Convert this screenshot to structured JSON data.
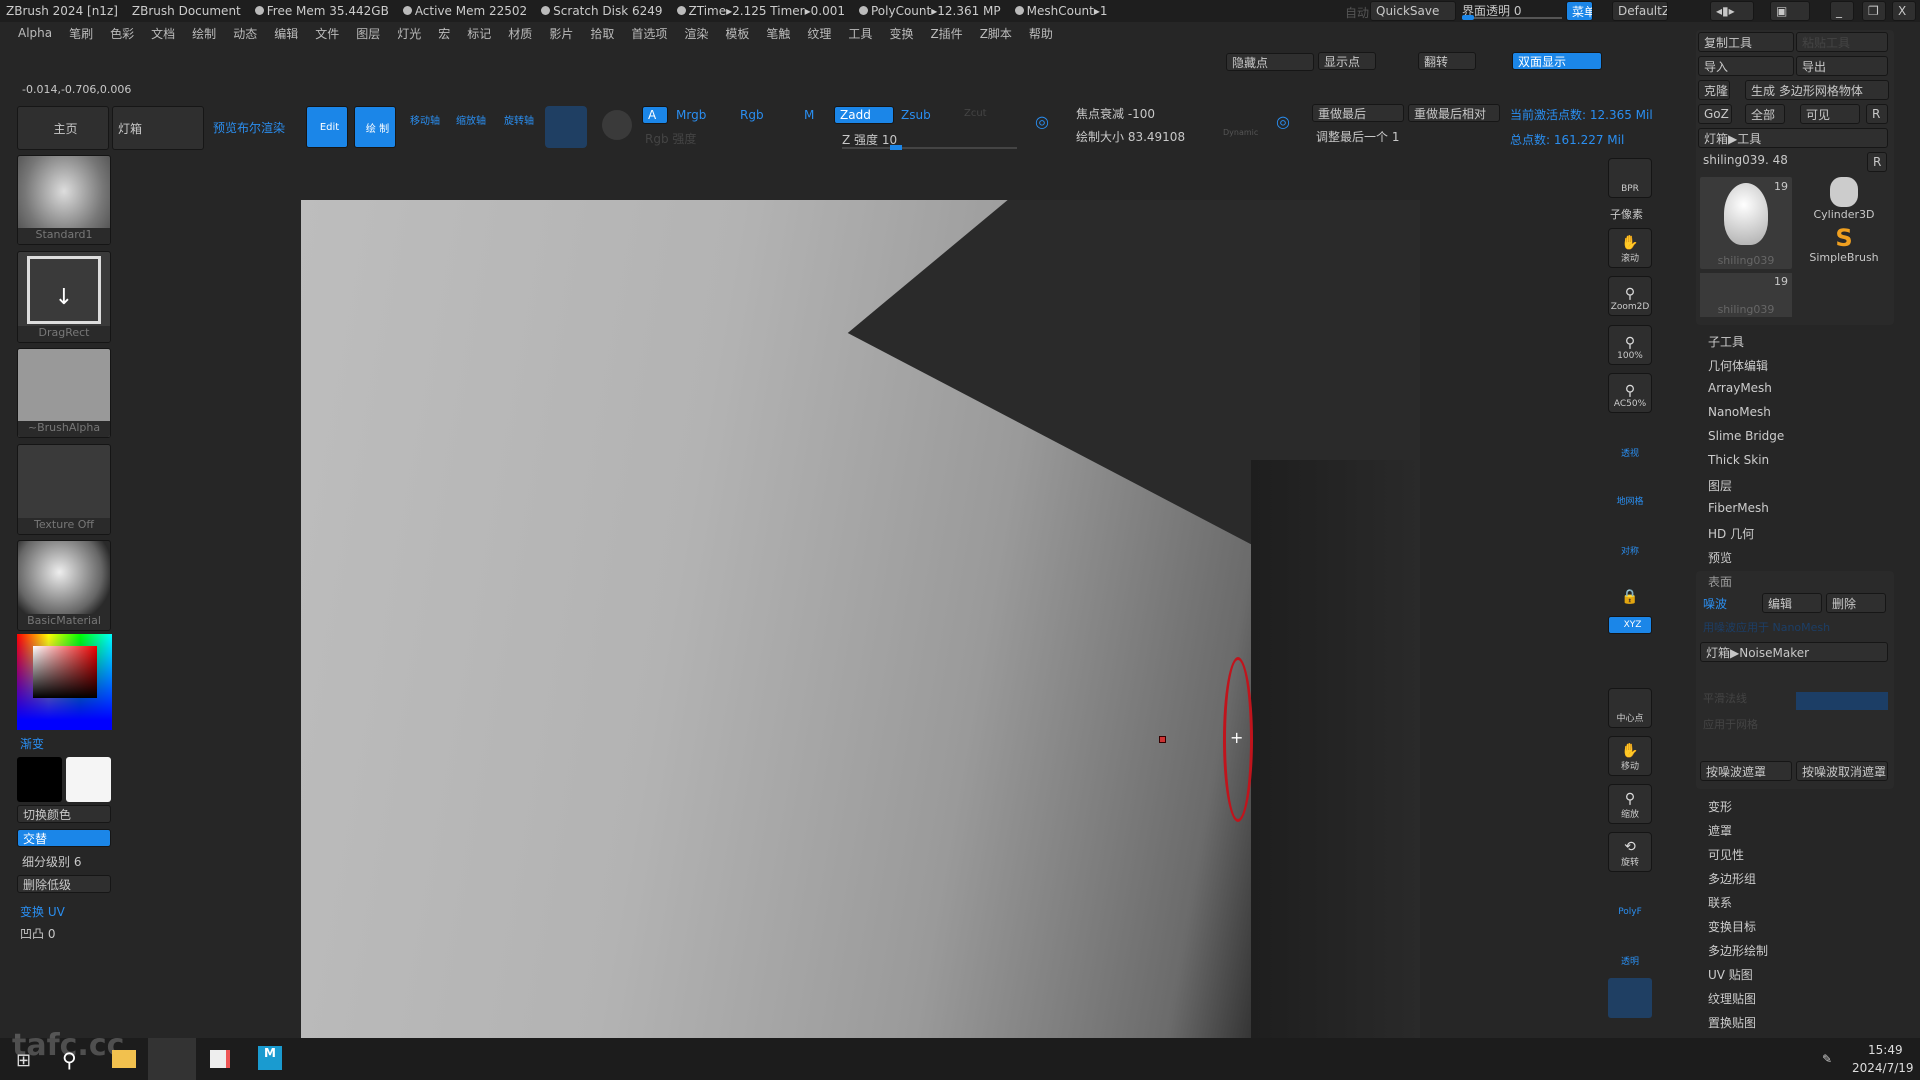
{
  "title": {
    "app": "ZBrush 2024 [n1z]",
    "doc": "ZBrush Document",
    "free_mem": "Free Mem 35.442GB",
    "active_mem": "Active Mem 22502",
    "scratch": "Scratch Disk 6249",
    "ztime": "ZTime▸2.125 Timer▸0.001",
    "polycount": "PolyCount▸12.361 MP",
    "meshcount": "MeshCount▸1",
    "auto": "自动",
    "quicksave": "QuickSave",
    "ui_opacity": "界面透明 0",
    "menu": "菜单",
    "script": "DefaultZScript"
  },
  "menus": [
    "Alpha",
    "笔刷",
    "色彩",
    "文档",
    "绘制",
    "动态",
    "编辑",
    "文件",
    "图层",
    "灯光",
    "宏",
    "标记",
    "材质",
    "影片",
    "拾取",
    "首选项",
    "渲染",
    "模板",
    "笔触",
    "纹理",
    "工具",
    "变换",
    "Z插件",
    "Z脚本",
    "帮助"
  ],
  "coords": "-0.014,-0.706,0.006",
  "toolbar": {
    "home": "主页",
    "lightbox": "灯箱",
    "preview_boolean": "预览布尔渲染",
    "edit": "Edit",
    "draw": "绘 制",
    "move": "移动轴",
    "scale": "缩放轴",
    "rotate": "旋转轴",
    "a": "A",
    "mrgb": "Mrgb",
    "rgb": "Rgb",
    "m": "M",
    "zadd": "Zadd",
    "zsub": "Zsub",
    "zcut": "Zcut",
    "rgb_intensity": "Rgb 强度",
    "z_intensity": "Z 强度 10",
    "focal": "焦点衰减 -100",
    "draw_size": "绘制大小 83.49108",
    "dynamic": "Dynamic",
    "redo_last": "重做最后",
    "redo_last_rel": "重做最后相对",
    "adjust_last": "调整最后一个 1",
    "active_points": "当前激活点数: 12.365 Mil",
    "total_points": "总点数: 161.227 Mil",
    "hide_pts": "隐藏点",
    "show_pts": "显示点",
    "flip": "翻转",
    "double": "双面显示"
  },
  "left": {
    "brush": "Standard1",
    "stroke": "DragRect",
    "alpha": "~BrushAlpha",
    "texture": "Texture Off",
    "material": "BasicMaterial",
    "gradient": "渐变",
    "switch_color": "切换颜色",
    "alternate": "交替",
    "subdiv": "细分级别 6",
    "del_lower": "删除低级",
    "switch_uv": "变换 UV",
    "bump": "凹凸 0"
  },
  "shelf": [
    "BPR",
    "子像素",
    "滚动",
    "Zoom2D",
    "100%",
    "AC50%",
    "透视",
    "地网格",
    "对称",
    "",
    "XYZ",
    "中心点",
    "移动",
    "缩放",
    "旋转",
    "PolyF",
    "透明"
  ],
  "right": {
    "copy_tool": "复制工具",
    "paste_tool": "粘贴工具",
    "import": "导入",
    "export": "导出",
    "clone": "克隆",
    "make_poly": "生成 多边形网格物体",
    "goz": "GoZ",
    "all": "全部",
    "visible": "可见",
    "r": "R",
    "lightbox_tools": "灯箱▶工具",
    "tool_slider": "shiling039. 48",
    "tools": [
      {
        "name": "shiling039",
        "count": "19"
      },
      {
        "name": "Cylinder3D"
      },
      {
        "name": "SimpleBrush"
      },
      {
        "name": "shiling039",
        "count": "19"
      }
    ],
    "sections1": [
      "子工具",
      "几何体编辑",
      "ArrayMesh",
      "NanoMesh",
      "Slime Bridge",
      "Thick Skin",
      "图层",
      "FiberMesh",
      "HD 几何",
      "预览"
    ],
    "surface": "表面",
    "noise": "噪波",
    "edit": "编辑",
    "delete": "删除",
    "nanomesh": "用噪波应用于 NanoMesh",
    "noisemaker": "灯箱▶NoiseMaker",
    "smooth": "平滑法线",
    "apply_mesh": "应用于网格",
    "mask_noise": "按噪波遮罩",
    "unmask_noise": "按噪波取消遮罩",
    "sections2": [
      "变形",
      "遮罩",
      "可见性",
      "多边形组",
      "联系",
      "变换目标",
      "多边形绘制",
      "UV 贴图",
      "纹理贴图",
      "置换贴图"
    ]
  },
  "taskbar": {
    "time": "15:49",
    "date": "2024/7/19",
    "watermark": "tafc.cc"
  },
  "colors": {
    "accent": "#1b86e8",
    "brush_ring": "#c0141c"
  }
}
